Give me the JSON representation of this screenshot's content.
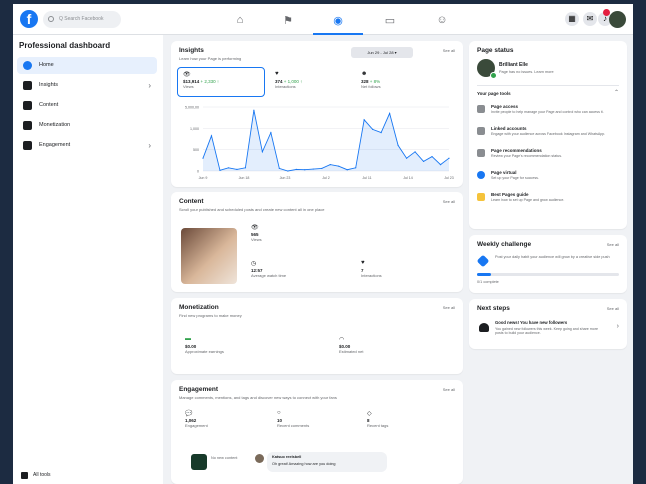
{
  "topbar": {
    "search_placeholder": "Q Search Facebook",
    "nav_tabs": [
      "home",
      "flag",
      "pages",
      "video",
      "emoji"
    ],
    "icons": [
      "menu-grid-icon",
      "messenger-icon",
      "bell-icon"
    ]
  },
  "sidebar": {
    "title": "Professional dashboard",
    "items": [
      {
        "label": "Home",
        "icon": "home-icon",
        "active": true
      },
      {
        "label": "Insights",
        "icon": "insights-icon",
        "chevron": true
      },
      {
        "label": "Content",
        "icon": "content-icon"
      },
      {
        "label": "Monetization",
        "icon": "monetization-icon"
      },
      {
        "label": "Engagement",
        "icon": "engagement-icon",
        "chevron": true
      }
    ],
    "bottom_label": "All tools"
  },
  "insights": {
    "title": "Insights",
    "subtitle": "Learn how your Page is performing",
    "date_range": "Jun 29 - Jul 28 ▾",
    "period": "Jul 28 ▾",
    "see_all": "See all",
    "metrics": [
      {
        "icon": "eye-icon",
        "value": "$13,914",
        "delta": "+ 2,330 ↑",
        "label": "Views"
      },
      {
        "icon": "heart-icon",
        "value": "374",
        "delta": "+ 1,000 ↑",
        "label": "Interactions"
      },
      {
        "icon": "user-icon",
        "value": "328",
        "delta": "+ 8%",
        "label": "Net follows"
      }
    ]
  },
  "chart_data": {
    "type": "area",
    "x": [
      "Jun 9",
      "Jun 18",
      "Jun 23",
      "Jul 2",
      "Jul 11",
      "Jul 14",
      "Jul 23"
    ],
    "yticks": [
      "5,000,00",
      "1,000",
      "500",
      "0"
    ],
    "series": [
      {
        "values": [
          40,
          110,
          2,
          10,
          5,
          10,
          190,
          60,
          120,
          8,
          0,
          5,
          4,
          6,
          8,
          20,
          15,
          4,
          10,
          160,
          130,
          120,
          180,
          80,
          40,
          60,
          30,
          45,
          20,
          40
        ]
      }
    ],
    "color": "#1877f2"
  },
  "content": {
    "title": "Content",
    "subtitle": "Scroll your published and scheduled posts and create new content all in one place",
    "see_all": "See all",
    "metrics": [
      {
        "icon": "eye-icon",
        "value": "565",
        "label": "Views"
      },
      {
        "icon": "clock-icon",
        "value": "12:57",
        "label": "Average watch time"
      },
      {
        "icon": "heart-icon",
        "value": "7",
        "label": "Interactions"
      }
    ]
  },
  "monetization": {
    "title": "Monetization",
    "subtitle": "Find new programs to make money",
    "see_all": "See all",
    "metrics": [
      {
        "icon": "money-icon",
        "value": "$0.00",
        "label": "Approximate earnings"
      },
      {
        "icon": "gauge-icon",
        "value": "$0.00",
        "label": "Estimated net"
      }
    ]
  },
  "engagement": {
    "title": "Engagement",
    "subtitle": "Manage comments, mentions, and tags and discover new ways to connect with your fans",
    "see_all": "See all",
    "metrics": [
      {
        "icon": "comment-icon",
        "value": "1,062",
        "label": "Engagement"
      },
      {
        "icon": "heart-icon",
        "value": "10",
        "label": "Recent comments"
      },
      {
        "icon": "tag-icon",
        "value": "8",
        "label": "Recent tags"
      }
    ],
    "post": {
      "label": "No new content"
    },
    "comment": {
      "author": "Katsuo reelsbell",
      "text": "Oh great! Amazing how are you doing"
    }
  },
  "page_status": {
    "title": "Page status",
    "name": "Brilliant Elle",
    "subtitle": "Page has no issues. Learn more",
    "tools_label": "Your page tools",
    "tools": [
      {
        "title": "Page access",
        "desc": "Invite people to help manage your Page and control who can access it.",
        "icon": "key-icon"
      },
      {
        "title": "Linked accounts",
        "desc": "Engage with your audience across Facebook Instagram and WhatsApp.",
        "icon": "link-icon"
      },
      {
        "title": "Page recommendations",
        "desc": "Review your Page's recommendation status.",
        "icon": "star-icon"
      },
      {
        "title": "Page virtual",
        "desc": "Set up your Page for success.",
        "icon": "globe-icon"
      },
      {
        "title": "Best Pages guide",
        "desc": "Learn how to set up Page and grow audience.",
        "icon": "book-icon"
      }
    ]
  },
  "weekly": {
    "title": "Weekly challenge",
    "see_all": "See all",
    "text": "Post your daily habit your audience will grow by a creative side push",
    "progress_label": "0/1 complete",
    "progress_fraction": 0.1
  },
  "next_steps": {
    "title": "Next steps",
    "see_all": "See all",
    "item_title": "Good news! You have new followers",
    "item_desc": "You gained new followers this week. Keep going and share more posts to build your audience."
  }
}
